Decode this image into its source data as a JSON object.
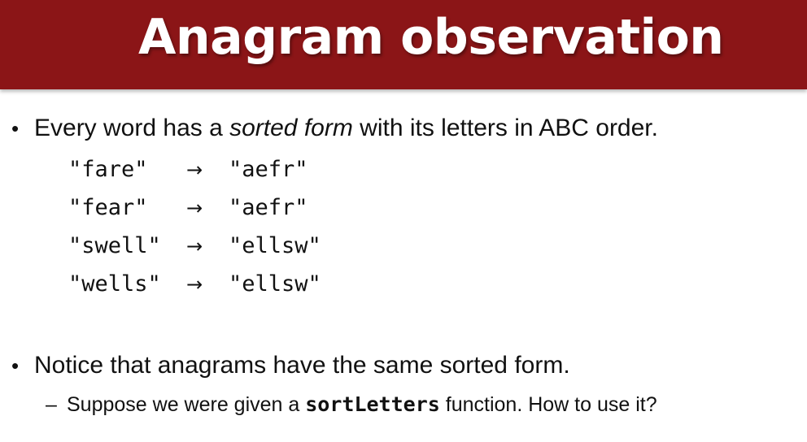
{
  "slide": {
    "title": "Anagram observation",
    "bullet1": {
      "before": "Every word has a ",
      "emphasis": "sorted form",
      "after": " with its letters in ABC order."
    },
    "examples": [
      {
        "word": "\"fare\"",
        "arrow": "→",
        "sorted": "\"aefr\""
      },
      {
        "word": "\"fear\"",
        "arrow": "→",
        "sorted": "\"aefr\""
      },
      {
        "word": "\"swell\"",
        "arrow": "→",
        "sorted": "\"ellsw\""
      },
      {
        "word": "\"wells\"",
        "arrow": "→",
        "sorted": "\"ellsw\""
      }
    ],
    "bullet2": "Notice that anagrams have the same sorted form.",
    "subbullet": {
      "dash": "–",
      "before": "Suppose we were given a ",
      "code": "sortLetters",
      "after": " function.  How to use it?"
    },
    "bullet_symbol": "•",
    "colors": {
      "title_bar": "#8b1517",
      "title_text": "#ffffff",
      "body_text": "#111111"
    }
  }
}
